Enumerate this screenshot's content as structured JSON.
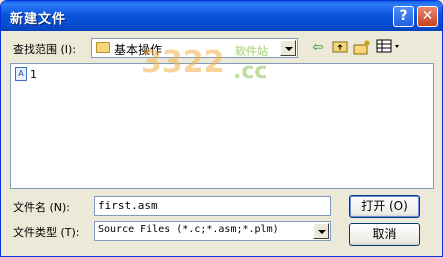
{
  "window": {
    "title": "新建文件"
  },
  "title_buttons": {
    "help": "?",
    "close": "✕"
  },
  "lookin": {
    "label": "查找范围 (I):",
    "value": "基本操作"
  },
  "toolbar": {
    "icons": [
      "back-arrow-icon",
      "up-folder-icon",
      "new-folder-icon",
      "view-menu-icon"
    ]
  },
  "files": [
    {
      "name": "1"
    }
  ],
  "filename": {
    "label": "文件名 (N):",
    "value": "first.asm"
  },
  "filetype": {
    "label": "文件类型 (T):",
    "value": "Source Files (*.c;*.asm;*.plm)"
  },
  "buttons": {
    "open": "打开 (O)",
    "cancel": "取消"
  },
  "watermark": {
    "number": "3322",
    "domain": ".cc",
    "site": "软件站"
  }
}
